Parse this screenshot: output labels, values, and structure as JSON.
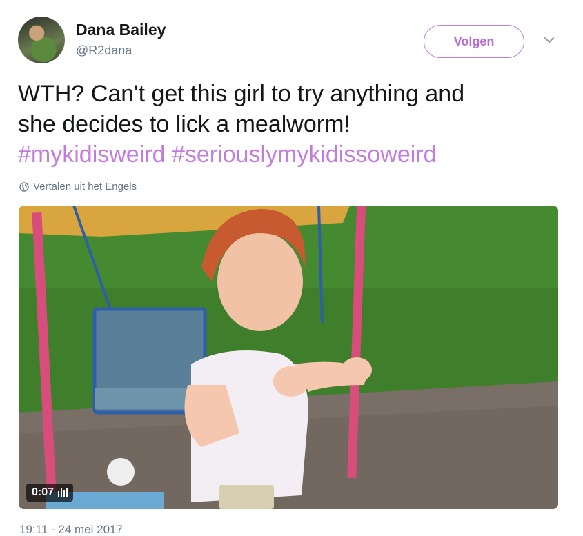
{
  "author": {
    "name": "Dana Bailey",
    "handle": "@R2dana",
    "avatar_icon": "profile-photo"
  },
  "header": {
    "follow_label": "Volgen",
    "menu_icon": "chevron-down-icon"
  },
  "tweet": {
    "text_lines": [
      "WTH? Can't get this girl to try anything and",
      "she decides to lick a mealworm!"
    ],
    "hashtags": [
      "#mykidisweird",
      "#seriouslymykidissoweird"
    ],
    "translate_label": "Vertalen uit het Engels"
  },
  "media": {
    "duration": "0:07",
    "type": "video"
  },
  "timestamp": "19:11 - 24 mei 2017",
  "colors": {
    "accent": "#c47be0",
    "text": "#14171a",
    "muted": "#657786"
  }
}
